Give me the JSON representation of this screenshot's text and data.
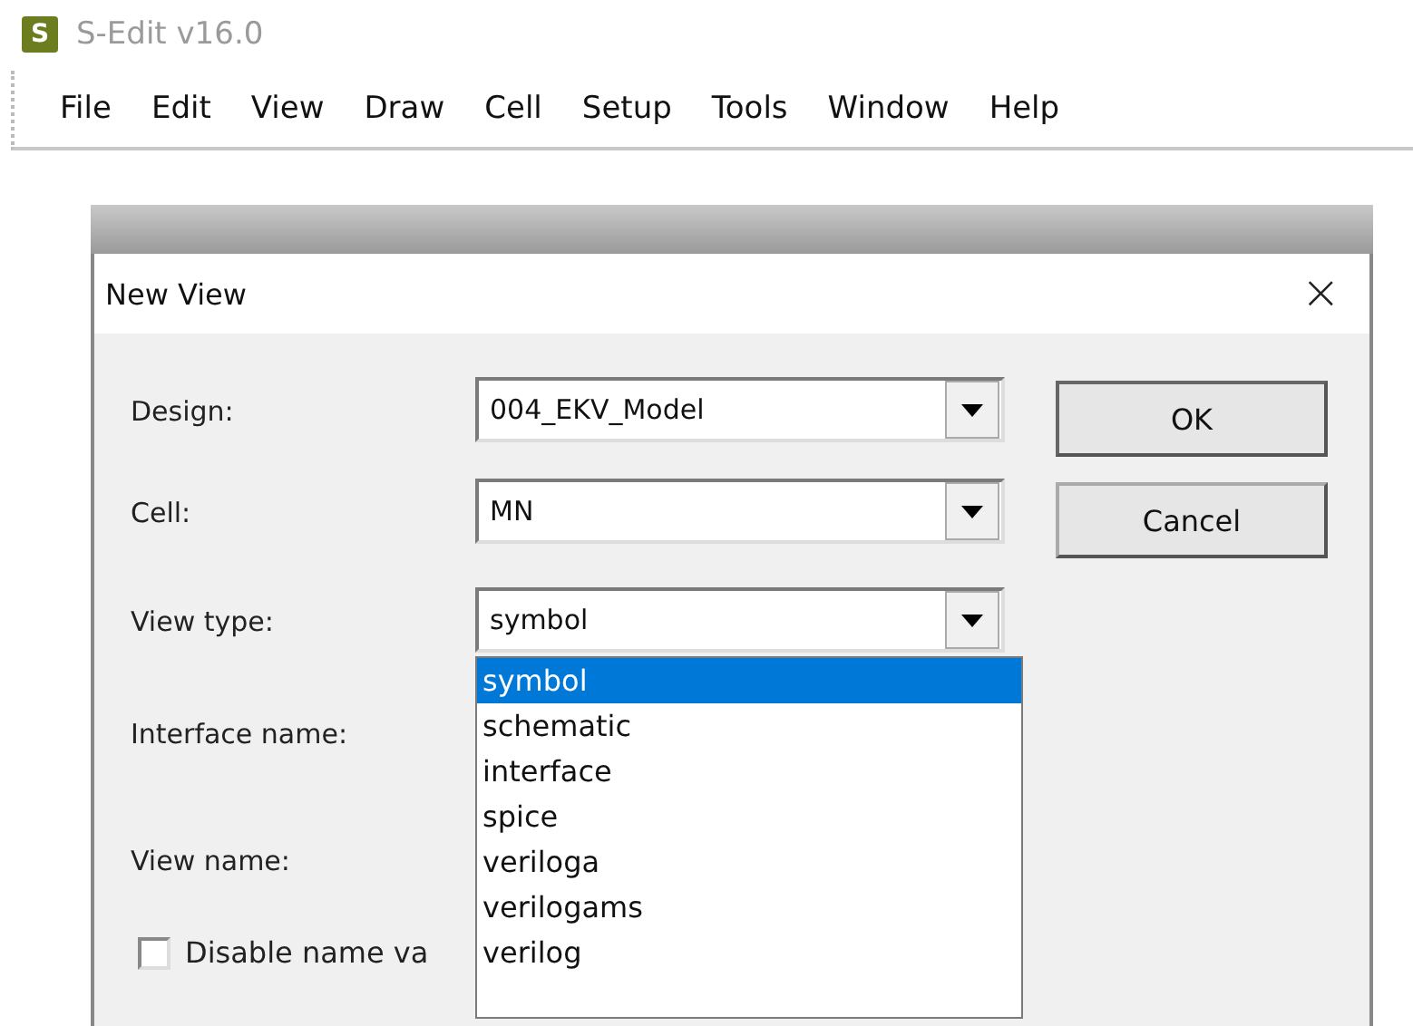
{
  "app": {
    "title": "S-Edit v16.0",
    "logo": "S"
  },
  "menu": [
    "File",
    "Edit",
    "View",
    "Draw",
    "Cell",
    "Setup",
    "Tools",
    "Window",
    "Help"
  ],
  "dialog": {
    "title": "New View",
    "close": "×",
    "fields": [
      {
        "label": "Design:",
        "kind": "combo",
        "value": "004_EKV_Model"
      },
      {
        "label": "Cell:",
        "kind": "combo",
        "value": "MN"
      },
      {
        "label": "View type:",
        "kind": "combo",
        "value": "symbol",
        "expanded": true,
        "options": [
          {
            "label": "symbol",
            "selected": true
          },
          {
            "label": "schematic",
            "selected": false
          },
          {
            "label": "interface",
            "selected": false
          },
          {
            "label": "spice",
            "selected": false
          },
          {
            "label": "veriloga",
            "selected": false
          },
          {
            "label": "verilogams",
            "selected": false
          },
          {
            "label": "verilog",
            "selected": false
          }
        ]
      },
      {
        "label": "Interface name:",
        "kind": "label"
      },
      {
        "label": "View name:",
        "kind": "label"
      },
      {
        "label": "Disable name va",
        "kind": "checkbox",
        "checked": false
      }
    ],
    "buttons": [
      "OK",
      "Cancel"
    ]
  }
}
